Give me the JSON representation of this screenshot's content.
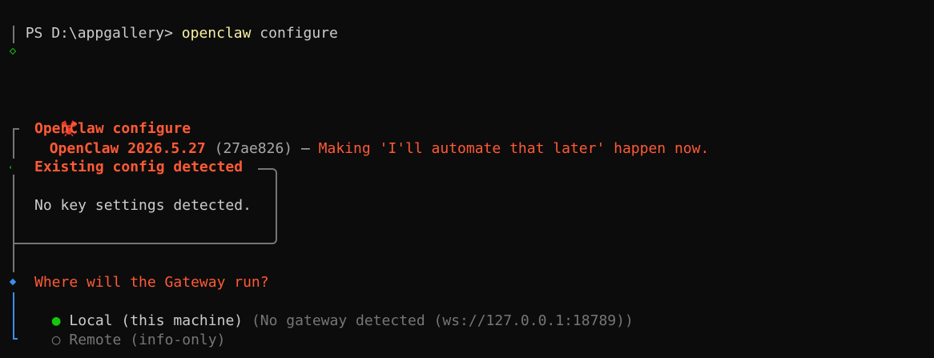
{
  "terminal": {
    "prompt": "PS D:\\appgallery> ",
    "command": "openclaw",
    "command_args": " configure"
  },
  "banner": {
    "product": "OpenClaw 2026.5.27",
    "commit": " (27ae826)",
    "dash": " — ",
    "tagline": "Making 'I'll automate that later' happen now."
  },
  "section_title": "OpenClaw configure",
  "note": {
    "title": "Existing config detected",
    "body": "No key settings detected."
  },
  "prompt_question": "Where will the Gateway run?",
  "options": [
    {
      "marker": "●",
      "label": "Local (this machine)",
      "hint": " (No gateway detected (ws://127.0.0.1:18789))",
      "selected": true
    },
    {
      "marker": "○",
      "label": "Remote (info-only)",
      "hint": "",
      "selected": false
    }
  ],
  "colors": {
    "background": "#0c0c0c",
    "accent_orange": "#ff5a36",
    "command_yellow": "#f9f1a5",
    "active_blue": "#3b8eea",
    "success_green": "#16c60c",
    "muted_gray": "#767676"
  },
  "icons": {
    "brand": "lobster-icon",
    "step_done": "diamond-outline-icon",
    "step_active": "diamond-filled-icon",
    "radio_selected": "radio-selected-icon",
    "radio_unselected": "radio-unselected-icon"
  }
}
